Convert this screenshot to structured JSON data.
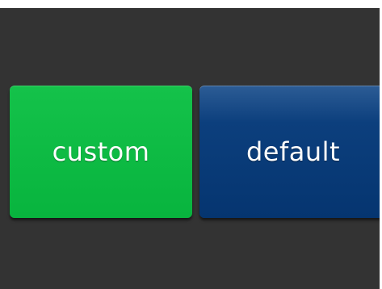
{
  "buttons": {
    "custom_label": "custom",
    "default_label": "default"
  },
  "colors": {
    "background": "#333333",
    "custom_button": "#0bb841",
    "default_button": "#063871",
    "text": "#ffffff"
  }
}
